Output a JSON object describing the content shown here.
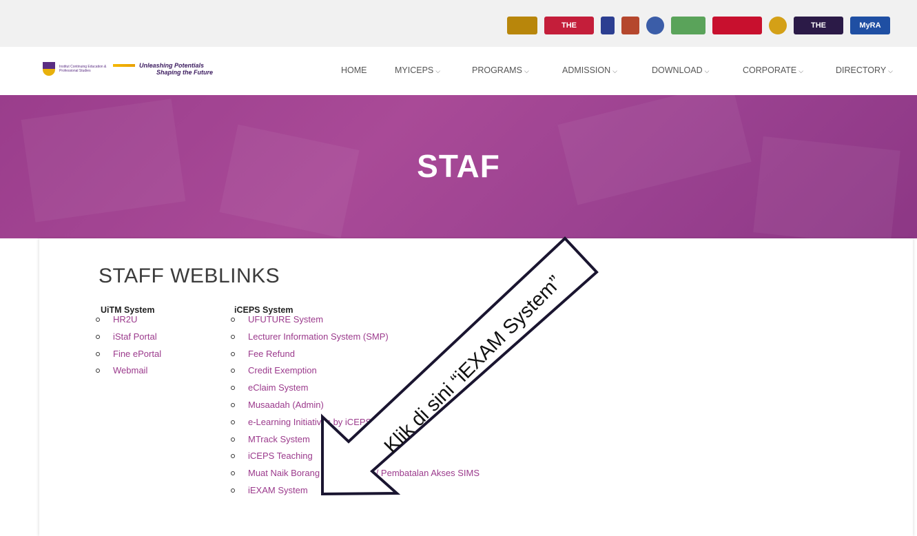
{
  "awards": [
    {
      "name": "ranking-badge",
      "text": "",
      "color": "#b8860b"
    },
    {
      "name": "the-badge",
      "text": "THE",
      "color": "#c41e3a"
    },
    {
      "name": "impact-badge",
      "text": "",
      "color": "#2c3e91"
    },
    {
      "name": "medal-badge",
      "text": "",
      "color": "#b5472d"
    },
    {
      "name": "seal-badge",
      "text": "",
      "color": "#3b5da8"
    },
    {
      "name": "star-badge",
      "text": "",
      "color": "#5aa35a"
    },
    {
      "name": "premier-badge",
      "text": "",
      "color": "#c8102e"
    },
    {
      "name": "gold-seal-badge",
      "text": "",
      "color": "#d4a017"
    },
    {
      "name": "the-ranking-badge",
      "text": "THE",
      "color": "#2b1a47"
    },
    {
      "name": "myra-badge",
      "text": "MyRA",
      "color": "#1f4fa3"
    }
  ],
  "header": {
    "logo_text": "Institut Continuing Education & Professional Studies",
    "tagline_line1": "Unleashing Potentials",
    "tagline_line2": "Shaping the Future"
  },
  "nav": {
    "items": [
      {
        "label": "HOME",
        "dropdown": false
      },
      {
        "label": "MYICEPS",
        "dropdown": true
      },
      {
        "label": "PROGRAMS",
        "dropdown": true
      },
      {
        "label": "ADMISSION",
        "dropdown": true
      },
      {
        "label": "DOWNLOAD",
        "dropdown": true
      },
      {
        "label": "CORPORATE",
        "dropdown": true
      },
      {
        "label": "DIRECTORY",
        "dropdown": true
      }
    ],
    "chevron": "⌵"
  },
  "banner": {
    "title": "STAF"
  },
  "main": {
    "section_title": "STAFF WEBLINKS",
    "columns": [
      {
        "title": "UiTM System",
        "links": [
          "HR2U",
          "iStaf Portal",
          "Fine ePortal",
          "Webmail"
        ]
      },
      {
        "title": "iCEPS System",
        "links": [
          "UFUTURE System",
          "Lecturer Information System (SMP)",
          "Fee Refund",
          "Credit Exemption",
          "eClaim System",
          "Musaadah (Admin)",
          "e-Learning Initiatives by iCEPS",
          "MTrack System",
          "iCEPS Teaching",
          "Muat Naik Borang Permohonan / Pembatalan Akses SIMS",
          "iEXAM System"
        ]
      }
    ]
  },
  "annotation": {
    "text": "Klik di sini “iEXAM System”"
  },
  "colors": {
    "banner": "#a1468f",
    "link": "#9b3a8c",
    "award_bar": "#f1f1f1"
  }
}
